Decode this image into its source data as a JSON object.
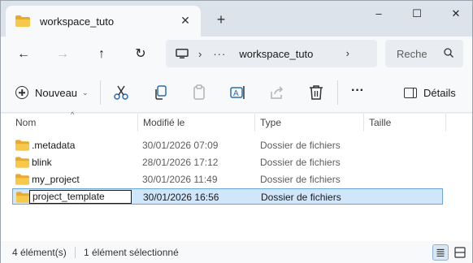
{
  "tab": {
    "title": "workspace_tuto",
    "close_icon": "close-icon",
    "new_tab_icon": "plus-icon"
  },
  "window_controls": {
    "minimize": "–",
    "maximize": "☐",
    "close": "✕"
  },
  "nav": {
    "back": "←",
    "forward": "→",
    "up": "↑",
    "refresh": "↻",
    "address": {
      "separator": "›",
      "ellipsis": "···",
      "current": "workspace_tuto",
      "chevron": "›"
    },
    "search_placeholder": "Reche"
  },
  "command_bar": {
    "new_label": "Nouveau",
    "new_caret": "⌄",
    "more": "···",
    "details_label": "Détails",
    "icons": [
      "cut-icon",
      "copy-icon",
      "paste-icon",
      "rename-icon",
      "share-icon",
      "delete-icon"
    ]
  },
  "columns": {
    "name": "Nom",
    "modified": "Modifié le",
    "type": "Type",
    "size": "Taille",
    "sort_caret": "^"
  },
  "files": [
    {
      "name": ".metadata",
      "modified": "30/01/2026 07:09",
      "type": "Dossier de fichiers",
      "selected": false
    },
    {
      "name": "blink",
      "modified": "28/01/2026 17:12",
      "type": "Dossier de fichiers",
      "selected": false
    },
    {
      "name": "my_project",
      "modified": "30/01/2026 11:49",
      "type": "Dossier de fichiers",
      "selected": false
    },
    {
      "name": "project_template",
      "modified": "30/01/2026 16:56",
      "type": "Dossier de fichiers",
      "selected": true,
      "renaming": true
    }
  ],
  "status": {
    "count": "4 élément(s)",
    "selection": "1 élément sélectionné"
  },
  "colors": {
    "accent": "#0067c0",
    "folder": "#f5c243",
    "selection_bg": "#cfe6fb",
    "selection_border": "#6aa6da"
  }
}
